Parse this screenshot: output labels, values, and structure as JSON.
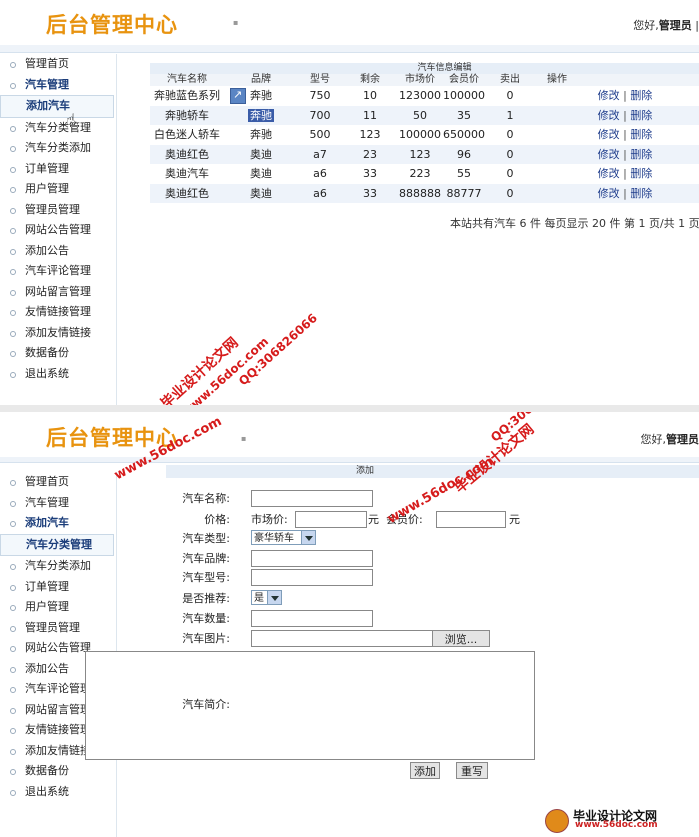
{
  "logo_text": "后台管理中心",
  "greeting_text": "您好,",
  "admin_name": "管理员",
  "separator_mark": "|",
  "sidebar_top": [
    "管理首页",
    "汽车管理",
    "添加汽车",
    "汽车分类管理",
    "汽车分类添加",
    "订单管理",
    "用户管理",
    "管理员管理",
    "网站公告管理",
    "添加公告",
    "汽车评论管理",
    "网站留言管理",
    "友情链接管理",
    "添加友情链接",
    "数据备份",
    "退出系统"
  ],
  "sidebar_bottom": [
    "管理首页",
    "汽车管理",
    "添加汽车",
    "汽车分类管理",
    "汽车分类添加",
    "订单管理",
    "用户管理",
    "管理员管理",
    "网站公告管理",
    "添加公告",
    "汽车评论管理",
    "网站留言管理",
    "友情链接管理",
    "添加友情链接",
    "数据备份",
    "退出系统"
  ],
  "table": {
    "title": "汽车信息编辑",
    "headers": [
      "汽车名称",
      "品牌",
      "型号",
      "剩余",
      "市场价",
      "会员价",
      "卖出",
      "操作"
    ],
    "rows": [
      [
        "奔驰蓝色系列",
        "奔驰",
        "750",
        "10",
        "123000",
        "100000",
        "0"
      ],
      [
        "奔驰轿车",
        "奔驰",
        "700",
        "11",
        "50",
        "35",
        "1"
      ],
      [
        "白色迷人轿车",
        "奔驰",
        "500",
        "123",
        "100000",
        "650000",
        "0"
      ],
      [
        "奥迪红色",
        "奥迪",
        "a7",
        "23",
        "123",
        "96",
        "0"
      ],
      [
        "奥迪汽车",
        "奥迪",
        "a6",
        "33",
        "223",
        "55",
        "0"
      ],
      [
        "奥迪红色",
        "奥迪",
        "a6",
        "33",
        "888888",
        "88777",
        "0"
      ]
    ],
    "edit_label": "修改",
    "delete_label": "删除",
    "pager": "本站共有汽车 6 件 每页显示 20 件 第 1 页/共 1 页"
  },
  "form": {
    "title": "添加",
    "name_label": "汽车名称:",
    "price_label": "价格:",
    "market_label": "市场价:",
    "member_label": "会员价:",
    "unit": "元",
    "type_label": "汽车类型:",
    "type_value": "豪华轿车",
    "brand_label": "汽车品牌:",
    "model_label": "汽车型号:",
    "recommend_label": "是否推荐:",
    "recommend_value": "是",
    "qty_label": "汽车数量:",
    "image_label": "汽车图片:",
    "browse_label": "浏览...",
    "intro_label": "汽车简介:",
    "add_button": "添加",
    "reset_button": "重写"
  },
  "watermarks": {
    "site_cn": "毕业设计论文网",
    "site_url": "www.56doc.com",
    "qq": "QQ:306826066",
    "footer_cn": "毕业设计论文网",
    "footer_url": "www.56doc.com"
  }
}
